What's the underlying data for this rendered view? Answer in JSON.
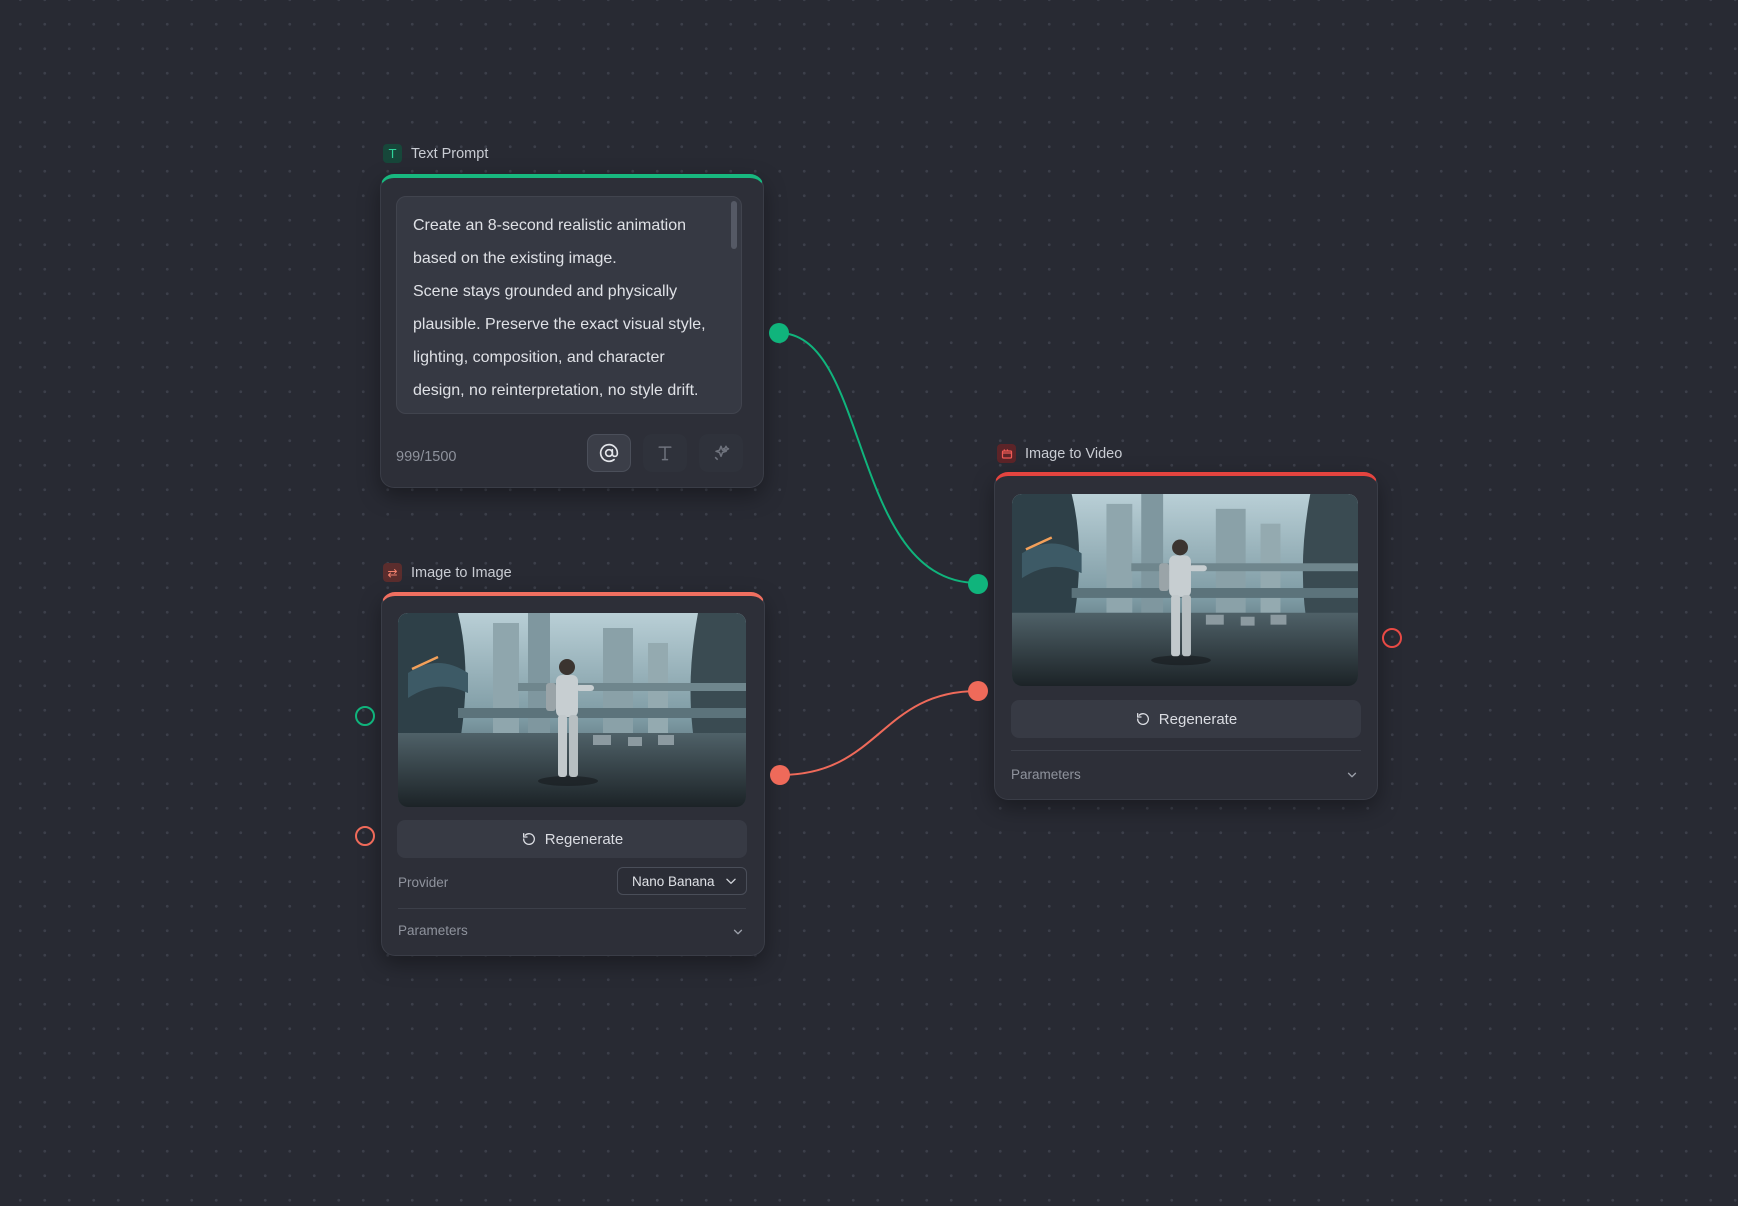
{
  "nodes": {
    "text_prompt": {
      "title": "Text Prompt",
      "icon": "text-t-icon",
      "accent": "#18b87f",
      "prompt": "Create an 8-second realistic animation\nbased on the existing image.\nScene stays grounded and physically\nplausible. Preserve the exact visual style,\nlighting, composition, and character\ndesign, no reinterpretation, no style drift.\nThe character is standing in a futuristic",
      "char_count": "999/1500",
      "tools": [
        "mention-icon",
        "text-format-icon",
        "magic-sparkle-icon"
      ]
    },
    "image_to_image": {
      "title": "Image to Image",
      "icon": "swap-arrows-icon",
      "accent": "#f06f60",
      "regenerate_label": "Regenerate",
      "provider_label": "Provider",
      "provider_value": "Nano Banana",
      "parameters_label": "Parameters"
    },
    "image_to_video": {
      "title": "Image to Video",
      "icon": "video-icon",
      "accent": "#e4443f",
      "regenerate_label": "Regenerate",
      "parameters_label": "Parameters"
    }
  },
  "connections": [
    {
      "from": "text_prompt.output",
      "to": "image_to_video.prompt_input",
      "color": "#10b47c"
    },
    {
      "from": "image_to_image.output",
      "to": "image_to_video.image_input",
      "color": "#ef6a5a"
    }
  ]
}
